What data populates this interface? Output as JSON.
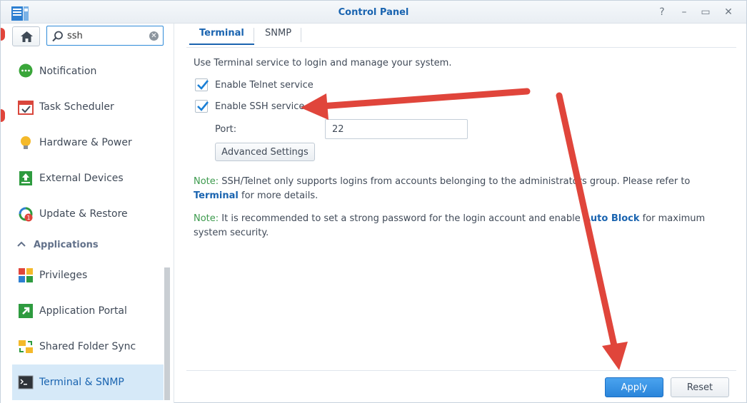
{
  "window": {
    "title": "Control Panel",
    "controls": [
      "help-icon",
      "pin-icon",
      "minimize-icon",
      "maximize-icon",
      "close-icon"
    ]
  },
  "search": {
    "value": "ssh",
    "placeholder": ""
  },
  "sidebar": {
    "items": [
      {
        "label": "Notification",
        "icon": "notification-icon"
      },
      {
        "label": "Task Scheduler",
        "icon": "task-scheduler-icon"
      },
      {
        "label": "Hardware & Power",
        "icon": "lightbulb-icon"
      },
      {
        "label": "External Devices",
        "icon": "external-devices-icon"
      },
      {
        "label": "Update & Restore",
        "icon": "update-restore-icon",
        "badge": "1"
      }
    ],
    "section": "Applications",
    "app_items": [
      {
        "label": "Privileges",
        "icon": "privileges-icon"
      },
      {
        "label": "Application Portal",
        "icon": "application-portal-icon"
      },
      {
        "label": "Shared Folder Sync",
        "icon": "shared-folder-sync-icon"
      },
      {
        "label": "Terminal & SNMP",
        "icon": "terminal-icon",
        "active": true
      }
    ]
  },
  "tabs": [
    {
      "label": "Terminal",
      "active": true
    },
    {
      "label": "SNMP",
      "active": false
    }
  ],
  "terminal": {
    "description": "Use Terminal service to login and manage your system.",
    "telnet_label": "Enable Telnet service",
    "telnet_checked": true,
    "ssh_label": "Enable SSH service",
    "ssh_checked": true,
    "port_label": "Port:",
    "port_value": "22",
    "advanced_label": "Advanced Settings"
  },
  "notes": {
    "label": "Note:",
    "note1_text": " SSH/Telnet only supports logins from accounts belonging to the administrators group. Please refer to ",
    "note1_link": "Terminal",
    "note1_tail": " for more details.",
    "note2_text": " It is recommended to set a strong password for the login account and enable ",
    "note2_link": "Auto Block",
    "note2_tail": " for maximum system security."
  },
  "footer": {
    "apply_label": "Apply",
    "reset_label": "Reset"
  },
  "colors": {
    "accent": "#1a64b0",
    "apply": "#2a85da",
    "note": "#3c9a4d",
    "arrow": "#e0453b"
  }
}
